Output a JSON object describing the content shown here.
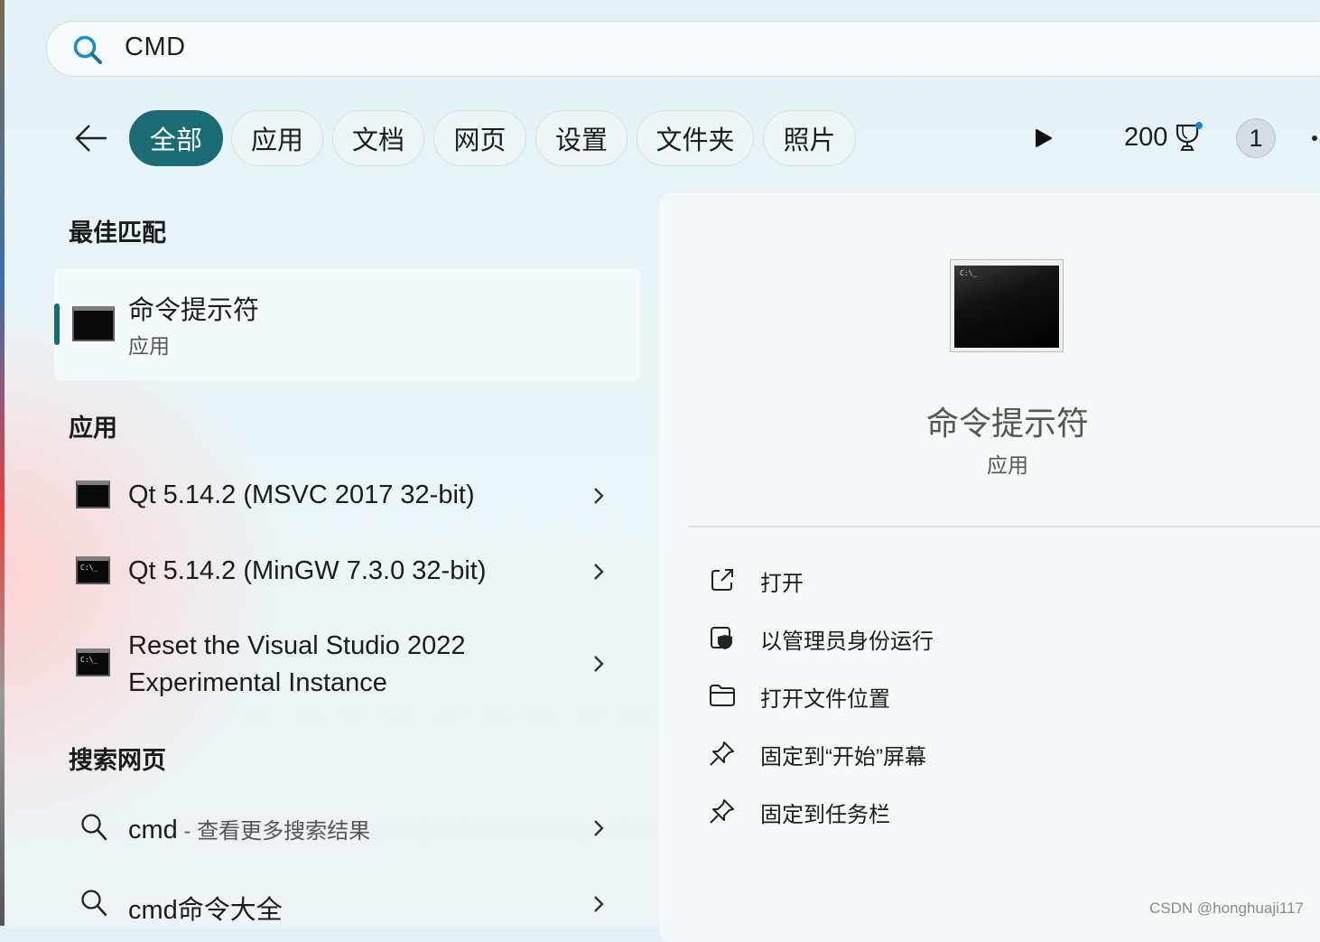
{
  "search": {
    "query": "CMD"
  },
  "filters": {
    "tabs": [
      {
        "label": "全部",
        "active": true
      },
      {
        "label": "应用",
        "active": false
      },
      {
        "label": "文档",
        "active": false
      },
      {
        "label": "网页",
        "active": false
      },
      {
        "label": "设置",
        "active": false
      },
      {
        "label": "文件夹",
        "active": false
      },
      {
        "label": "照片",
        "active": false
      }
    ],
    "points": "200",
    "avatar_text": "1"
  },
  "best_match": {
    "heading": "最佳匹配",
    "title": "命令提示符",
    "subtitle": "应用"
  },
  "apps": {
    "heading": "应用",
    "items": [
      {
        "line1": "Qt 5.14.2 (MSVC 2017 32-bit)",
        "line2": ""
      },
      {
        "line1": "Qt 5.14.2 (MinGW 7.3.0 32-bit)",
        "line2": ""
      },
      {
        "line1": "Reset the Visual Studio 2022",
        "line2": "Experimental Instance"
      }
    ]
  },
  "web": {
    "heading": "搜索网页",
    "items": [
      {
        "query": "cmd",
        "separator": " - ",
        "hint": "查看更多搜索结果"
      },
      {
        "query": "cmd命令大全",
        "separator": "",
        "hint": ""
      }
    ]
  },
  "preview": {
    "title": "命令提示符",
    "subtitle": "应用",
    "actions": [
      {
        "label": "打开",
        "icon": "open-external-icon"
      },
      {
        "label": "以管理员身份运行",
        "icon": "admin-shield-icon"
      },
      {
        "label": "打开文件位置",
        "icon": "folder-icon"
      },
      {
        "label": "固定到“开始”屏幕",
        "icon": "pin-icon"
      },
      {
        "label": "固定到任务栏",
        "icon": "pin-icon"
      }
    ]
  },
  "watermark": "CSDN @honghuaji117",
  "colors": {
    "accent": "#1b6b75",
    "search_icon": "#1a8fc4"
  }
}
